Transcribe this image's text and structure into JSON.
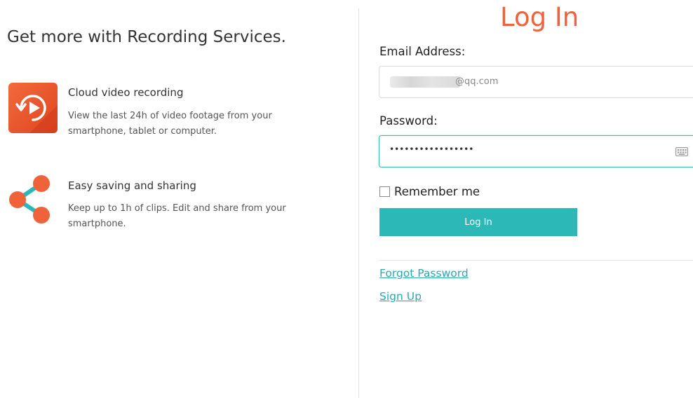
{
  "promo": {
    "headline": "Get more with Recording Services.",
    "features": [
      {
        "icon": "cloud-video-icon",
        "title": "Cloud video recording",
        "description": "View the last 24h of video footage from your smartphone, tablet or computer."
      },
      {
        "icon": "share-icon",
        "title": "Easy saving and sharing",
        "description": "Keep up to 1h of clips. Edit and share from your smartphone."
      }
    ]
  },
  "login": {
    "title": "Log In",
    "email_label": "Email Address:",
    "email_value_suffix": "@qq.com",
    "password_label": "Password:",
    "password_masked": "•••••••••••••••••",
    "remember_label": "Remember me",
    "remember_checked": false,
    "submit_label": "Log In",
    "forgot_link": "Forgot Password",
    "signup_link": "Sign Up"
  },
  "colors": {
    "accent_orange": "#f0623a",
    "accent_teal": "#2db8b8",
    "link_teal": "#2aa8b4"
  }
}
